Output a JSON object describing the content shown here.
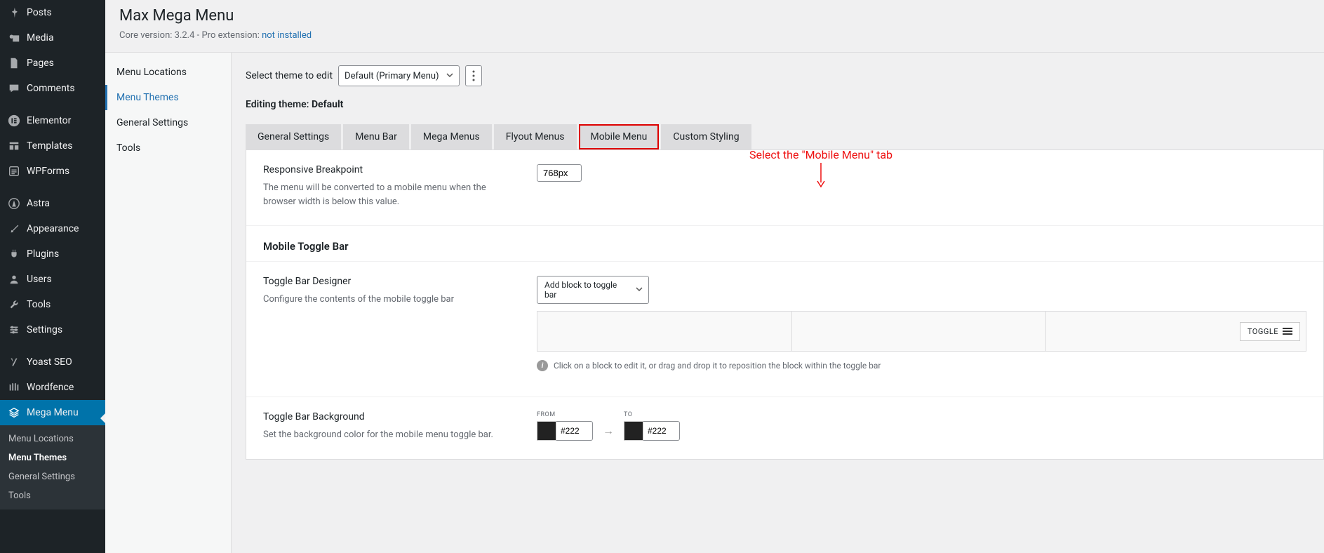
{
  "sidebar": {
    "items": [
      {
        "label": "Posts"
      },
      {
        "label": "Media"
      },
      {
        "label": "Pages"
      },
      {
        "label": "Comments"
      },
      {
        "label": "Elementor"
      },
      {
        "label": "Templates"
      },
      {
        "label": "WPForms"
      },
      {
        "label": "Astra"
      },
      {
        "label": "Appearance"
      },
      {
        "label": "Plugins"
      },
      {
        "label": "Users"
      },
      {
        "label": "Tools"
      },
      {
        "label": "Settings"
      },
      {
        "label": "Yoast SEO"
      },
      {
        "label": "Wordfence"
      },
      {
        "label": "Mega Menu"
      }
    ],
    "submenu": [
      {
        "label": "Menu Locations"
      },
      {
        "label": "Menu Themes"
      },
      {
        "label": "General Settings"
      },
      {
        "label": "Tools"
      }
    ]
  },
  "header": {
    "title": "Max Mega Menu",
    "core_prefix": "Core version: ",
    "core_version": "3.2.4",
    "pro_prefix": " - Pro extension: ",
    "not_installed": "not installed"
  },
  "inner_nav": [
    "Menu Locations",
    "Menu Themes",
    "General Settings",
    "Tools"
  ],
  "select_row": {
    "label": "Select theme to edit",
    "value": "Default (Primary Menu)"
  },
  "editing": {
    "prefix": "Editing theme: ",
    "name": "Default"
  },
  "annotation": "Select the \"Mobile Menu\" tab",
  "tabs": [
    "General Settings",
    "Menu Bar",
    "Mega Menus",
    "Flyout Menus",
    "Mobile Menu",
    "Custom Styling"
  ],
  "settings": {
    "breakpoint": {
      "title": "Responsive Breakpoint",
      "desc": "The menu will be converted to a mobile menu when the browser width is below this value.",
      "value": "768px"
    },
    "toggle_header": "Mobile Toggle Bar",
    "designer": {
      "title": "Toggle Bar Designer",
      "desc": "Configure the contents of the mobile toggle bar",
      "add_label": "Add block to toggle bar",
      "toggle_label": "TOGGLE",
      "hint": "Click on a block to edit it, or drag and drop it to reposition the block within the toggle bar"
    },
    "bg": {
      "title": "Toggle Bar Background",
      "desc": "Set the background color for the mobile menu toggle bar.",
      "from_label": "FROM",
      "to_label": "TO",
      "from": "#222",
      "to": "#222"
    }
  }
}
